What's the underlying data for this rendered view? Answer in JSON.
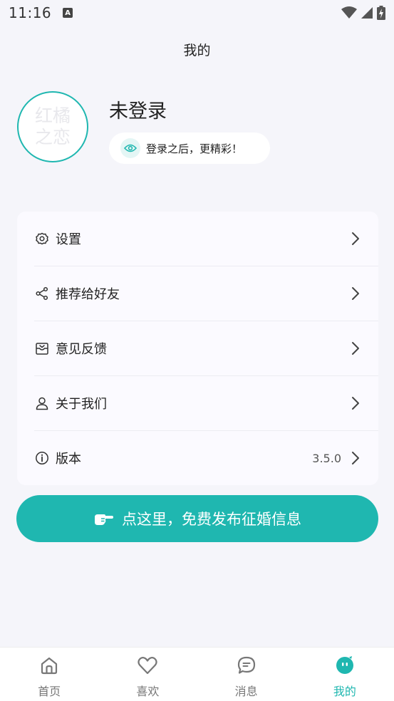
{
  "status_bar": {
    "time": "11:16",
    "notification_letter": "A"
  },
  "header": {
    "title": "我的"
  },
  "profile": {
    "avatar_text_line1": "红橘",
    "avatar_text_line2": "之恋",
    "name": "未登录",
    "login_hint": "登录之后，更精彩！",
    "hint_icon": "eye-icon"
  },
  "menu": {
    "items": [
      {
        "label": "设置",
        "icon": "gear-icon"
      },
      {
        "label": "推荐给好友",
        "icon": "share-icon"
      },
      {
        "label": "意见反馈",
        "icon": "feedback-inbox-icon"
      },
      {
        "label": "关于我们",
        "icon": "user-icon"
      },
      {
        "label": "版本",
        "icon": "info-icon",
        "value": "3.5.0"
      }
    ]
  },
  "cta": {
    "label": "点这里，免费发布征婚信息",
    "icon": "pointing-hand-icon"
  },
  "bottom_nav": {
    "tabs": [
      {
        "label": "首页",
        "icon": "home-icon"
      },
      {
        "label": "喜欢",
        "icon": "heart-icon"
      },
      {
        "label": "消息",
        "icon": "message-icon"
      },
      {
        "label": "我的",
        "icon": "mine-icon",
        "active": true
      }
    ]
  },
  "colors": {
    "accent": "#1fb7b0",
    "background": "#f5f5fa",
    "card": "#fbfaff",
    "nav_inactive": "#777777"
  }
}
